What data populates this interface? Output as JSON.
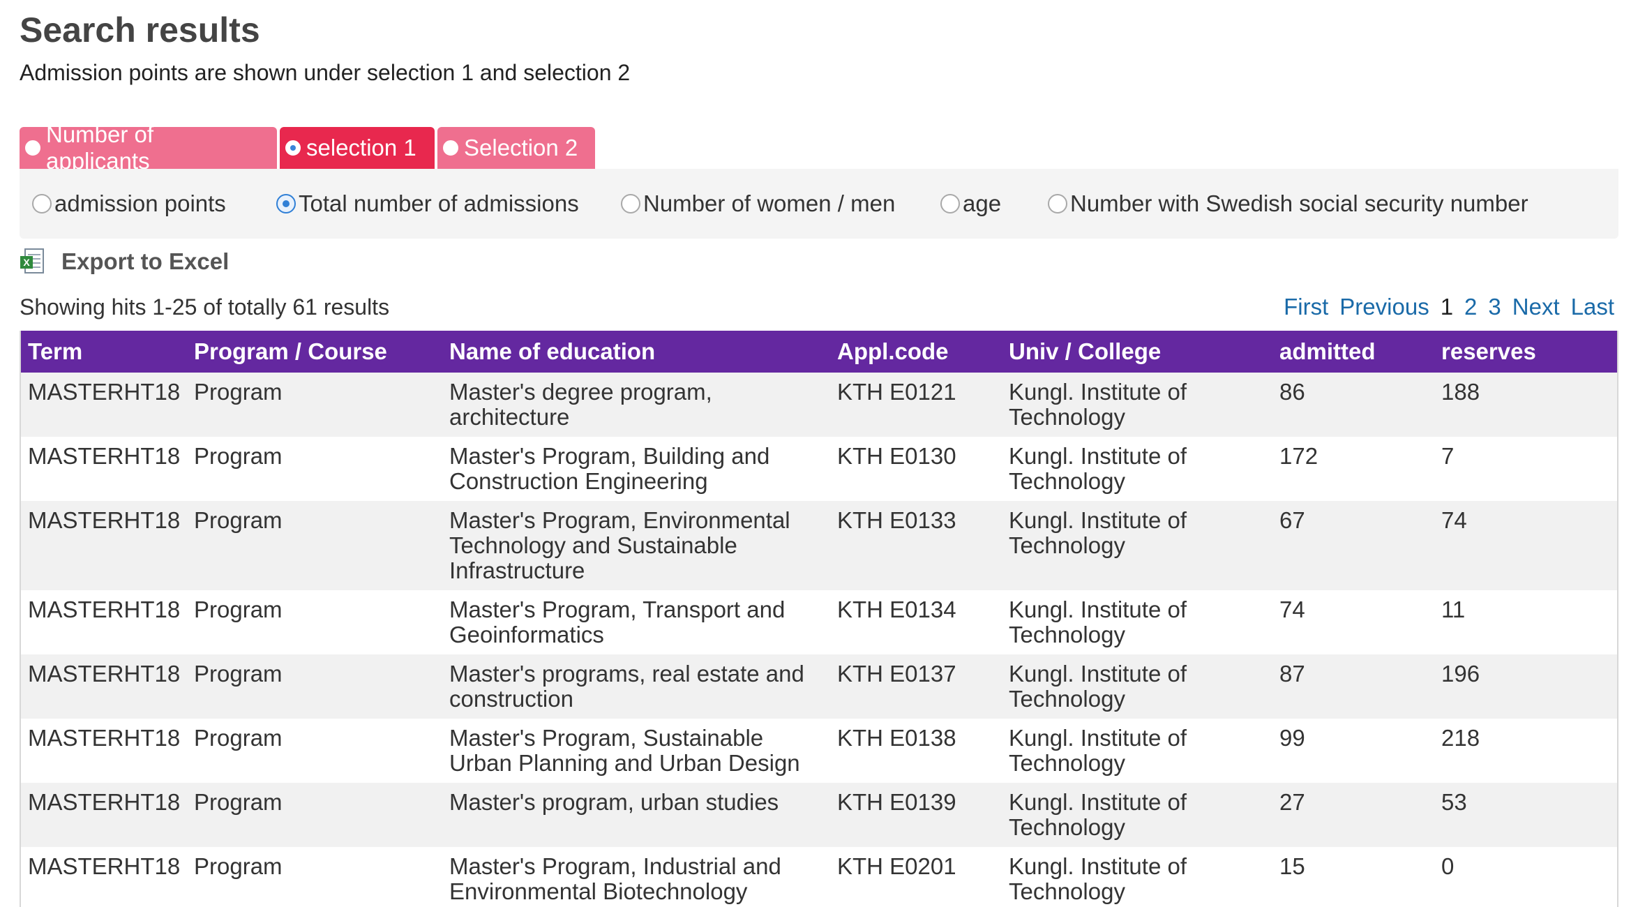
{
  "header": {
    "title": "Search results",
    "subtitle": "Admission points are shown under selection 1 and selection 2"
  },
  "tabs": [
    {
      "label": "Number of applicants",
      "selected": false
    },
    {
      "label": "selection 1",
      "selected": true
    },
    {
      "label": "Selection 2",
      "selected": false
    }
  ],
  "options": [
    {
      "label": "admission points",
      "selected": false
    },
    {
      "label": "Total number of admissions",
      "selected": true
    },
    {
      "label": "Number of women / men",
      "selected": false
    },
    {
      "label": "age",
      "selected": false
    },
    {
      "label": "Number with Swedish social security number",
      "selected": false
    }
  ],
  "export": {
    "label": "Export to Excel",
    "icon": "excel-icon"
  },
  "results": {
    "showing": "Showing hits 1-25 of totally 61 results"
  },
  "pager": {
    "first": "First",
    "previous": "Previous",
    "pages": [
      "1",
      "2",
      "3"
    ],
    "current": "1",
    "next": "Next",
    "last": "Last"
  },
  "colors": {
    "tab_active": "#e8284e",
    "tab_inactive": "#ef6f8f",
    "table_header": "#6428a0",
    "link": "#1a6aa8"
  },
  "table": {
    "columns": [
      "Term",
      "Program / Course",
      "Name of education",
      "Appl.code",
      "Univ / College",
      "admitted",
      "reserves"
    ],
    "rows": [
      [
        "MASTERHT18",
        "Program",
        "Master's degree program, architecture",
        "KTH E0121",
        "Kungl. Institute of Technology",
        "86",
        "188"
      ],
      [
        "MASTERHT18",
        "Program",
        "Master's Program, Building and Construction Engineering",
        "KTH E0130",
        "Kungl. Institute of Technology",
        "172",
        "7"
      ],
      [
        "MASTERHT18",
        "Program",
        "Master's Program, Environmental Technology and Sustainable Infrastructure",
        "KTH E0133",
        "Kungl. Institute of Technology",
        "67",
        "74"
      ],
      [
        "MASTERHT18",
        "Program",
        "Master's Program, Transport and Geoinformatics",
        "KTH E0134",
        "Kungl. Institute of Technology",
        "74",
        "11"
      ],
      [
        "MASTERHT18",
        "Program",
        "Master's programs, real estate and construction",
        "KTH E0137",
        "Kungl. Institute of Technology",
        "87",
        "196"
      ],
      [
        "MASTERHT18",
        "Program",
        "Master's Program, Sustainable Urban Planning and Urban Design",
        "KTH E0138",
        "Kungl. Institute of Technology",
        "99",
        "218"
      ],
      [
        "MASTERHT18",
        "Program",
        "Master's program, urban studies",
        "KTH E0139",
        "Kungl. Institute of Technology",
        "27",
        "53"
      ],
      [
        "MASTERHT18",
        "Program",
        "Master's Program, Industrial and Environmental Biotechnology",
        "KTH E0201",
        "Kungl. Institute of Technology",
        "15",
        "0"
      ]
    ]
  }
}
